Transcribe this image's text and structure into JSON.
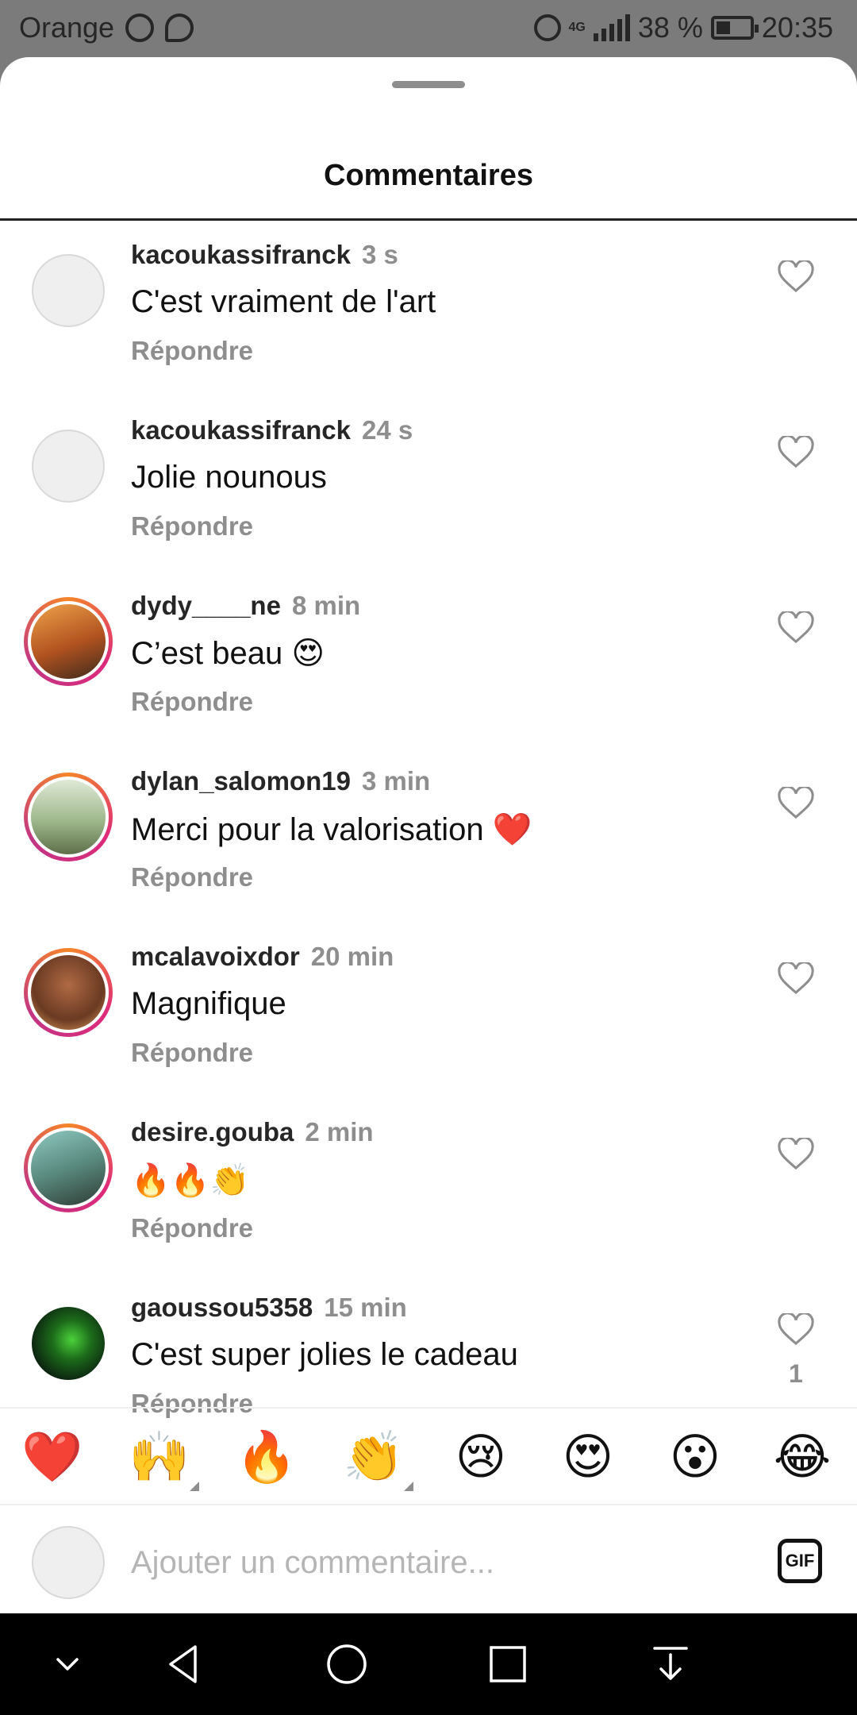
{
  "status_bar": {
    "carrier": "Orange",
    "network": "4G",
    "battery": "38 %",
    "time": "20:35"
  },
  "sheet": {
    "title": "Commentaires"
  },
  "comments": [
    {
      "username": "kacoukassifranck",
      "time": "3 s",
      "text": "C'est vraiment de l'art",
      "reply_label": "Répondre",
      "avatar": "placeholder-avatar"
    },
    {
      "username": "kacoukassifranck",
      "time": "24 s",
      "text": "Jolie nounous",
      "reply_label": "Répondre",
      "avatar": "placeholder-avatar"
    },
    {
      "username": "dydy____ne",
      "time": "8 min",
      "text": "C’est beau 😍",
      "reply_label": "Répondre",
      "avatar": "story-avatar"
    },
    {
      "username": "dylan_salomon19",
      "time": "3 min",
      "text": "Merci pour la valorisation ❤️",
      "reply_label": "Répondre",
      "avatar": "story-avatar"
    },
    {
      "username": "mcalavoixdor",
      "time": "20 min",
      "text": "Magnifique",
      "reply_label": "Répondre",
      "avatar": "story-avatar"
    },
    {
      "username": "desire.gouba",
      "time": "2 min",
      "text": "🔥🔥👏",
      "reply_label": "Répondre",
      "avatar": "story-avatar"
    },
    {
      "username": "gaoussou5358",
      "time": "15 min",
      "text": "C'est super jolies le cadeau",
      "reply_label": "Répondre",
      "likes": "1",
      "avatar": "dark-avatar"
    }
  ],
  "reactions": [
    "❤️",
    "🙌",
    "🔥",
    "👏",
    "😢",
    "😍",
    "😮",
    "😂"
  ],
  "input": {
    "placeholder": "Ajouter un commentaire...",
    "gif_label": "GIF"
  },
  "colors": {
    "secondary_text": "#8e8e8e",
    "story_ring": "#dd2a7b",
    "nav_bar": "#000000"
  }
}
